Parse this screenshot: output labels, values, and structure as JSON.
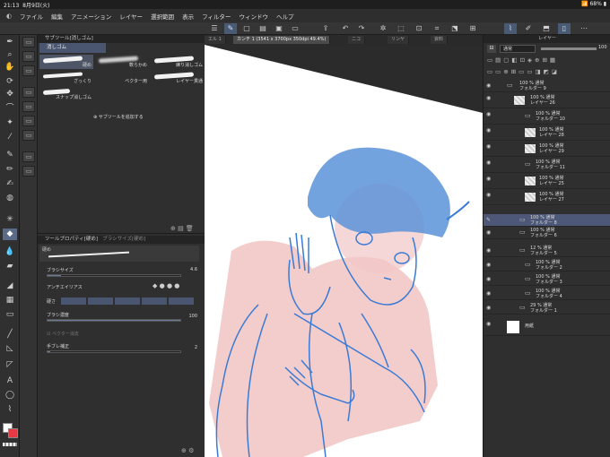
{
  "status": {
    "time": "21:13",
    "date": "8月9日(火)",
    "battery": "68%"
  },
  "menu": [
    "ファイル",
    "編集",
    "アニメーション",
    "レイヤー",
    "選択範囲",
    "表示",
    "フィルター",
    "ウィンドウ",
    "ヘルプ"
  ],
  "subtool": {
    "header": "サブツール[消しゴム]",
    "tab": "消しゴム",
    "brushes": [
      "硬め",
      "軟らかめ",
      "練り消しゴム",
      "ざっくり",
      "ベクター用",
      "レイヤー貫通",
      "スナップ消しゴム"
    ],
    "add_label": "サブツールを追加する"
  },
  "toolprop": {
    "header": "ツールプロパティ[硬め]",
    "header2": "ブラシサイズ[硬め]",
    "preview_label": "硬め",
    "brush_size_label": "ブラシサイズ",
    "brush_size_value": "4.6",
    "antialias_label": "アンチエイリアス",
    "hardness_label": "硬さ",
    "density_label": "ブラシ濃度",
    "density_value": "100",
    "vector_label": "ベクター消去",
    "stabilize_label": "手ブレ補正",
    "stabilize_value": "2"
  },
  "tabs": [
    "エル 1",
    "カンチ 1 (3541 x 3700px 350dpi 49.4%)",
    "ニコ",
    "リンヤ",
    "資料"
  ],
  "layers_panel": {
    "title": "レイヤー",
    "blend": "通常",
    "opacity": "100",
    "rows": [
      {
        "name": "フォルダー 9",
        "info": "100 % 通常",
        "type": "folder",
        "indent": 0
      },
      {
        "name": "レイヤー 26",
        "info": "100 % 通常",
        "type": "layer",
        "indent": 0
      },
      {
        "name": "フォルダー 10",
        "info": "100 % 通常",
        "type": "folder",
        "indent": 1
      },
      {
        "name": "レイヤー 28",
        "info": "100 % 通常",
        "type": "layer",
        "indent": 1
      },
      {
        "name": "レイヤー 29",
        "info": "100 % 通常",
        "type": "layer",
        "indent": 1
      },
      {
        "name": "フォルダー 11",
        "info": "100 % 通常",
        "type": "folder",
        "indent": 1
      },
      {
        "name": "レイヤー 25",
        "info": "100 % 通常",
        "type": "layer",
        "indent": 1
      },
      {
        "name": "レイヤー 27",
        "info": "100 % 通常",
        "type": "layer",
        "indent": 1
      },
      {
        "name": "フォルダー 8",
        "info": "100 % 通常",
        "type": "folder",
        "indent": 0,
        "selected": true
      },
      {
        "name": "フォルダー 6",
        "info": "100 % 通常",
        "type": "folder",
        "indent": 0
      },
      {
        "name": "フォルダー 5",
        "info": "12 % 通常",
        "type": "folder",
        "indent": 0
      },
      {
        "name": "フォルダー 2",
        "info": "100 % 通常",
        "type": "folder",
        "indent": 1
      },
      {
        "name": "フォルダー 3",
        "info": "100 % 通常",
        "type": "folder",
        "indent": 1
      },
      {
        "name": "フォルダー 4",
        "info": "100 % 通常",
        "type": "folder",
        "indent": 1
      },
      {
        "name": "フォルダー 1",
        "info": "29 % 通常",
        "type": "folder",
        "indent": 0
      },
      {
        "name": "用紙",
        "info": "",
        "type": "paper",
        "indent": 0
      }
    ]
  },
  "colors": {
    "accent": "#4d5878",
    "sketch_blue": "#3a7bd5",
    "skin_pink": "#f2c6c6",
    "main_color": "#ffffff",
    "sub_color": "#e63946"
  }
}
